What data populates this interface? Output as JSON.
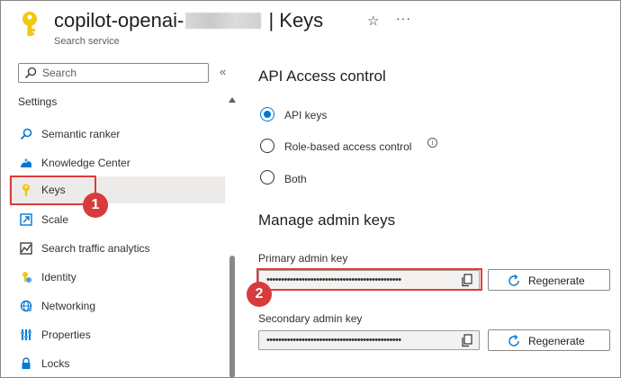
{
  "header": {
    "title_prefix": "copilot-openai-",
    "title_suffix": "| Keys",
    "subtitle": "Search service",
    "star_glyph": "☆",
    "more_glyph": "···"
  },
  "sidebar": {
    "search_placeholder": "Search",
    "collapse_glyph": "«",
    "section_label": "Settings",
    "items": [
      {
        "label": "Semantic ranker",
        "icon": "semantic-ranker-icon"
      },
      {
        "label": "Knowledge Center",
        "icon": "knowledge-center-icon"
      },
      {
        "label": "Keys",
        "icon": "key-icon",
        "active": true
      },
      {
        "label": "Scale",
        "icon": "scale-icon"
      },
      {
        "label": "Search traffic analytics",
        "icon": "analytics-icon"
      },
      {
        "label": "Identity",
        "icon": "identity-icon"
      },
      {
        "label": "Networking",
        "icon": "networking-icon"
      },
      {
        "label": "Properties",
        "icon": "properties-icon"
      },
      {
        "label": "Locks",
        "icon": "lock-icon"
      }
    ]
  },
  "callouts": [
    "1",
    "2"
  ],
  "access_control": {
    "heading": "API Access control",
    "options": [
      {
        "label": "API keys",
        "selected": true
      },
      {
        "label": "Role-based access control",
        "selected": false
      },
      {
        "label": "Both",
        "selected": false
      }
    ]
  },
  "admin_keys": {
    "heading": "Manage admin keys",
    "primary_label": "Primary admin key",
    "primary_value": "••••••••••••••••••••••••••••••••••••••••••••••",
    "secondary_label": "Secondary admin key",
    "secondary_value": "••••••••••••••••••••••••••••••••••••••••••••••",
    "regenerate_label": "Regenerate"
  },
  "colors": {
    "accent": "#0078d4",
    "callout": "#d83b3b",
    "key_gold": "#f2c811"
  }
}
